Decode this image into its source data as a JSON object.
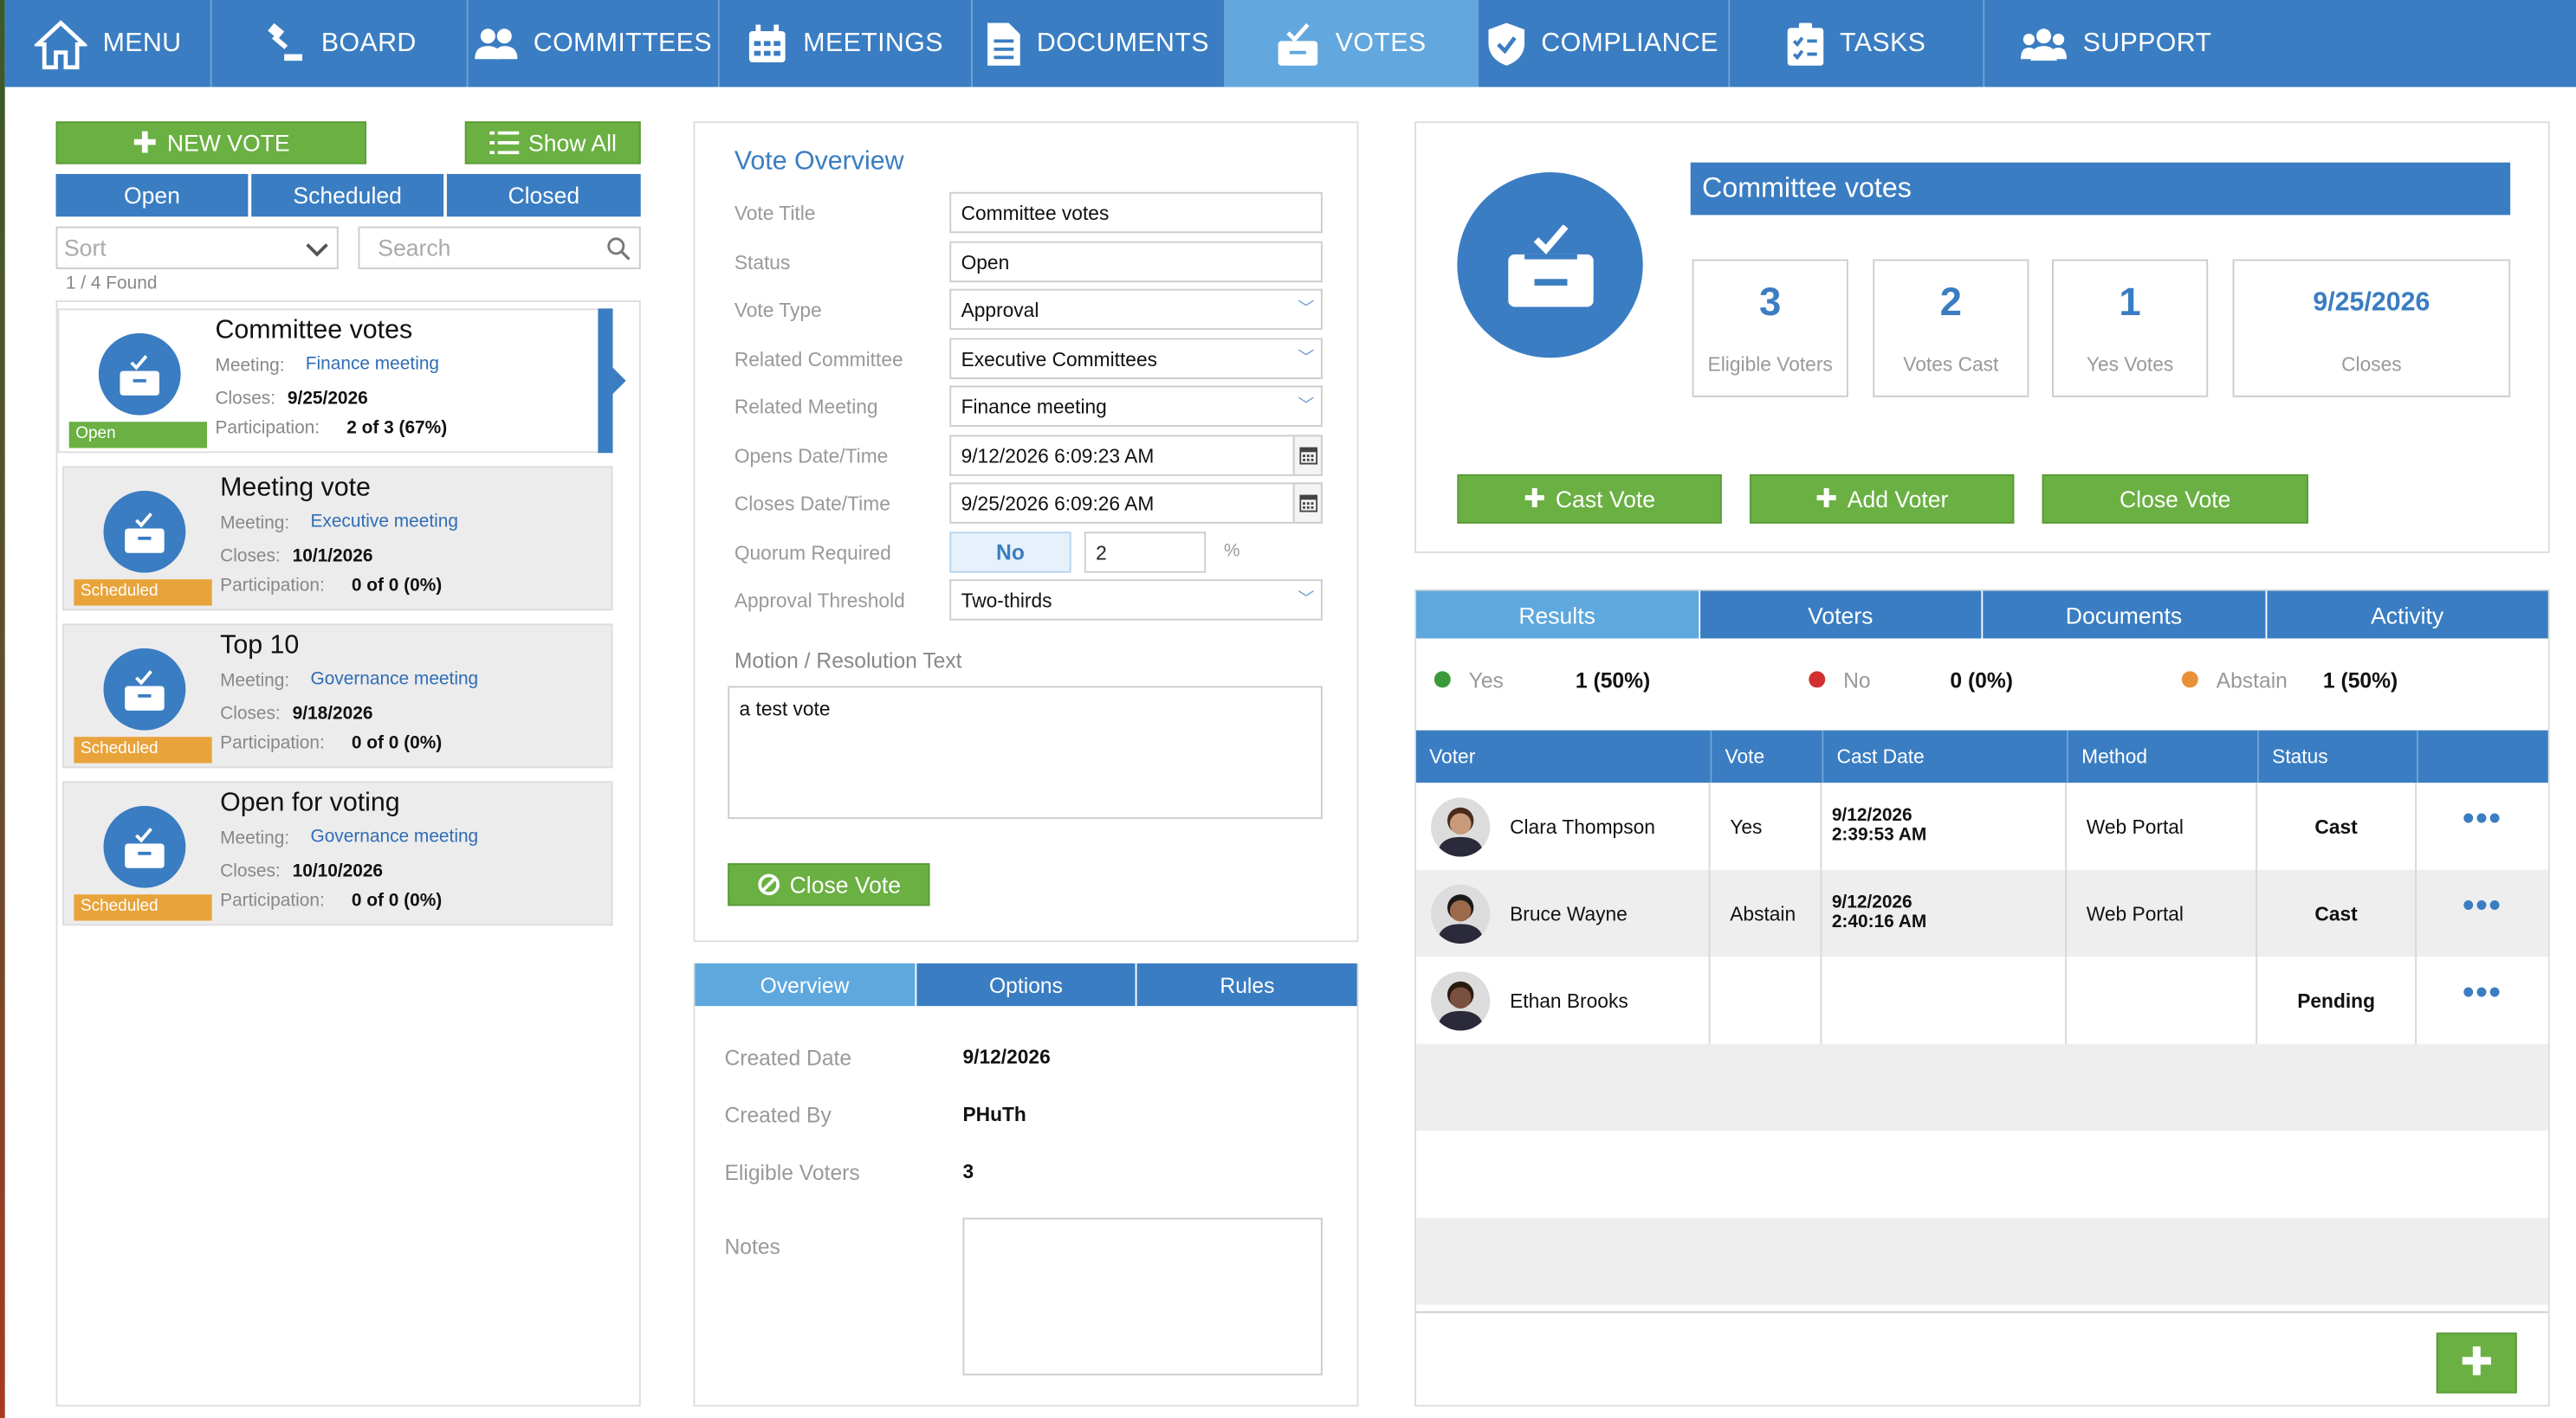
{
  "nav": {
    "items": [
      {
        "label": "MENU",
        "icon": "home-icon"
      },
      {
        "label": "BOARD",
        "icon": "gavel-icon"
      },
      {
        "label": "COMMITTEES",
        "icon": "people-icon"
      },
      {
        "label": "MEETINGS",
        "icon": "calendar-icon"
      },
      {
        "label": "DOCUMENTS",
        "icon": "document-icon"
      },
      {
        "label": "VOTES",
        "icon": "ballot-icon"
      },
      {
        "label": "COMPLIANCE",
        "icon": "shield-check-icon"
      },
      {
        "label": "TASKS",
        "icon": "checklist-icon"
      },
      {
        "label": "SUPPORT",
        "icon": "group-icon"
      }
    ],
    "active": "VOTES"
  },
  "left": {
    "new_vote": "NEW VOTE",
    "show_all": "Show All",
    "filters": [
      "Open",
      "Scheduled",
      "Closed"
    ],
    "sort_placeholder": "Sort",
    "search_placeholder": "Search",
    "found": "1 / 4 Found",
    "meeting_label": "Meeting:",
    "closes_label": "Closes:",
    "participation_label": "Participation:",
    "votes": [
      {
        "title": "Committee votes",
        "meeting": "Finance meeting",
        "closes": "9/25/2026",
        "participation": "2 of 3 (67%)",
        "status": "Open"
      },
      {
        "title": "Meeting vote",
        "meeting": "Executive meeting",
        "closes": "10/1/2026",
        "participation": "0 of 0 (0%)",
        "status": "Scheduled"
      },
      {
        "title": "Top 10",
        "meeting": "Governance meeting",
        "closes": "9/18/2026",
        "participation": "0 of 0 (0%)",
        "status": "Scheduled"
      },
      {
        "title": "Open for voting",
        "meeting": "Governance meeting",
        "closes": "10/10/2026",
        "participation": "0 of 0 (0%)",
        "status": "Scheduled"
      }
    ]
  },
  "overview": {
    "heading": "Vote Overview",
    "fields": {
      "vote_title": {
        "label": "Vote Title",
        "value": "Committee votes"
      },
      "status": {
        "label": "Status",
        "value": "Open"
      },
      "vote_type": {
        "label": "Vote Type",
        "value": "Approval"
      },
      "related_committee": {
        "label": "Related Committee",
        "value": "Executive Committees"
      },
      "related_meeting": {
        "label": "Related Meeting",
        "value": "Finance meeting"
      },
      "opens": {
        "label": "Opens Date/Time",
        "value": "9/12/2026 6:09:23 AM"
      },
      "closes": {
        "label": "Closes Date/Time",
        "value": "9/25/2026 6:09:26 AM"
      },
      "quorum": {
        "label": "Quorum Required",
        "value": "No",
        "number": "2",
        "unit": "%"
      },
      "threshold": {
        "label": "Approval Threshold",
        "value": "Two-thirds"
      }
    },
    "motion_label": "Motion / Resolution Text",
    "motion_text": "a test vote",
    "close_vote": "Close Vote"
  },
  "details": {
    "tabs": [
      "Overview",
      "Options",
      "Rules"
    ],
    "created_date_label": "Created Date",
    "created_date": "9/12/2026",
    "created_by_label": "Created By",
    "created_by": "PHuTh",
    "eligible_label": "Eligible Voters",
    "eligible": "3",
    "notes_label": "Notes"
  },
  "summary": {
    "title": "Committee votes",
    "stats": [
      {
        "value": "3",
        "label": "Eligible Voters"
      },
      {
        "value": "2",
        "label": "Votes Cast"
      },
      {
        "value": "1",
        "label": "Yes Votes"
      },
      {
        "value": "9/25/2026",
        "label": "Closes"
      }
    ],
    "buttons": {
      "cast": "Cast Vote",
      "add": "Add Voter",
      "close": "Close Vote"
    }
  },
  "results": {
    "tabs": [
      "Results",
      "Voters",
      "Documents",
      "Activity"
    ],
    "tallies": [
      {
        "label": "Yes",
        "value": "1 (50%)",
        "color": "#3a9a3a"
      },
      {
        "label": "No",
        "value": "0 (0%)",
        "color": "#d03030"
      },
      {
        "label": "Abstain",
        "value": "1 (50%)",
        "color": "#e8913a"
      }
    ],
    "columns": [
      "Voter",
      "Vote",
      "Cast Date",
      "Method",
      "Status"
    ],
    "rows": [
      {
        "name": "Clara Thompson",
        "vote": "Yes",
        "date1": "9/12/2026",
        "date2": "2:39:53 AM",
        "method": "Web Portal",
        "status": "Cast"
      },
      {
        "name": "Bruce Wayne",
        "vote": "Abstain",
        "date1": "9/12/2026",
        "date2": "2:40:16 AM",
        "method": "Web Portal",
        "status": "Cast"
      },
      {
        "name": "Ethan Brooks",
        "vote": "",
        "date1": "",
        "date2": "",
        "method": "",
        "status": "Pending"
      }
    ],
    "more": "•••"
  },
  "colors": {
    "primary": "#3a7dc2",
    "active_tab": "#5ea8de",
    "green": "#6ab042",
    "open_badge": "#6ab042",
    "scheduled_badge": "#e8a33a"
  }
}
